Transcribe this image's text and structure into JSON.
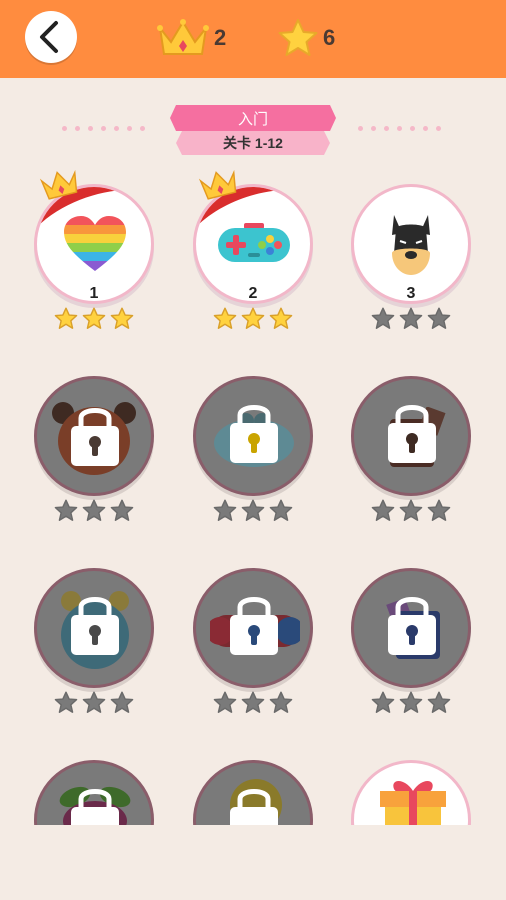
{
  "header": {
    "crowns_count": "2",
    "stars_count": "6",
    "colors": {
      "bar": "#ff8c3f",
      "crown": "#ffc93a",
      "star": "#ffd23f"
    }
  },
  "banner": {
    "title": "入门",
    "subtitle": "关卡 1-12",
    "colors": {
      "top": "#f56fa0",
      "bottom": "#f8b3c9"
    }
  },
  "levels": [
    {
      "num": "1",
      "icon": "rainbow-heart-icon",
      "state": "complete",
      "stars": 3,
      "crown": true
    },
    {
      "num": "2",
      "icon": "gamepad-icon",
      "state": "complete",
      "stars": 3,
      "crown": true
    },
    {
      "num": "3",
      "icon": "dog-icon",
      "state": "unlocked",
      "stars": 0,
      "crown": false
    },
    {
      "num": "",
      "icon": "bear-icon",
      "state": "locked",
      "stars": 0
    },
    {
      "num": "",
      "icon": "owl-icon",
      "state": "locked",
      "stars": 0
    },
    {
      "num": "",
      "icon": "bag-icon",
      "state": "locked",
      "stars": 0
    },
    {
      "num": "",
      "icon": "alarm-clock-icon",
      "state": "locked",
      "stars": 0
    },
    {
      "num": "",
      "icon": "car-icon",
      "state": "locked",
      "stars": 0
    },
    {
      "num": "",
      "icon": "book-icon",
      "state": "locked",
      "stars": 0
    },
    {
      "num": "",
      "icon": "plant-icon",
      "state": "locked",
      "stars": 0
    },
    {
      "num": "",
      "icon": "turtle-icon",
      "state": "locked",
      "stars": 0
    },
    {
      "num": "",
      "icon": "gift-icon",
      "state": "reward",
      "stars": 0
    }
  ]
}
